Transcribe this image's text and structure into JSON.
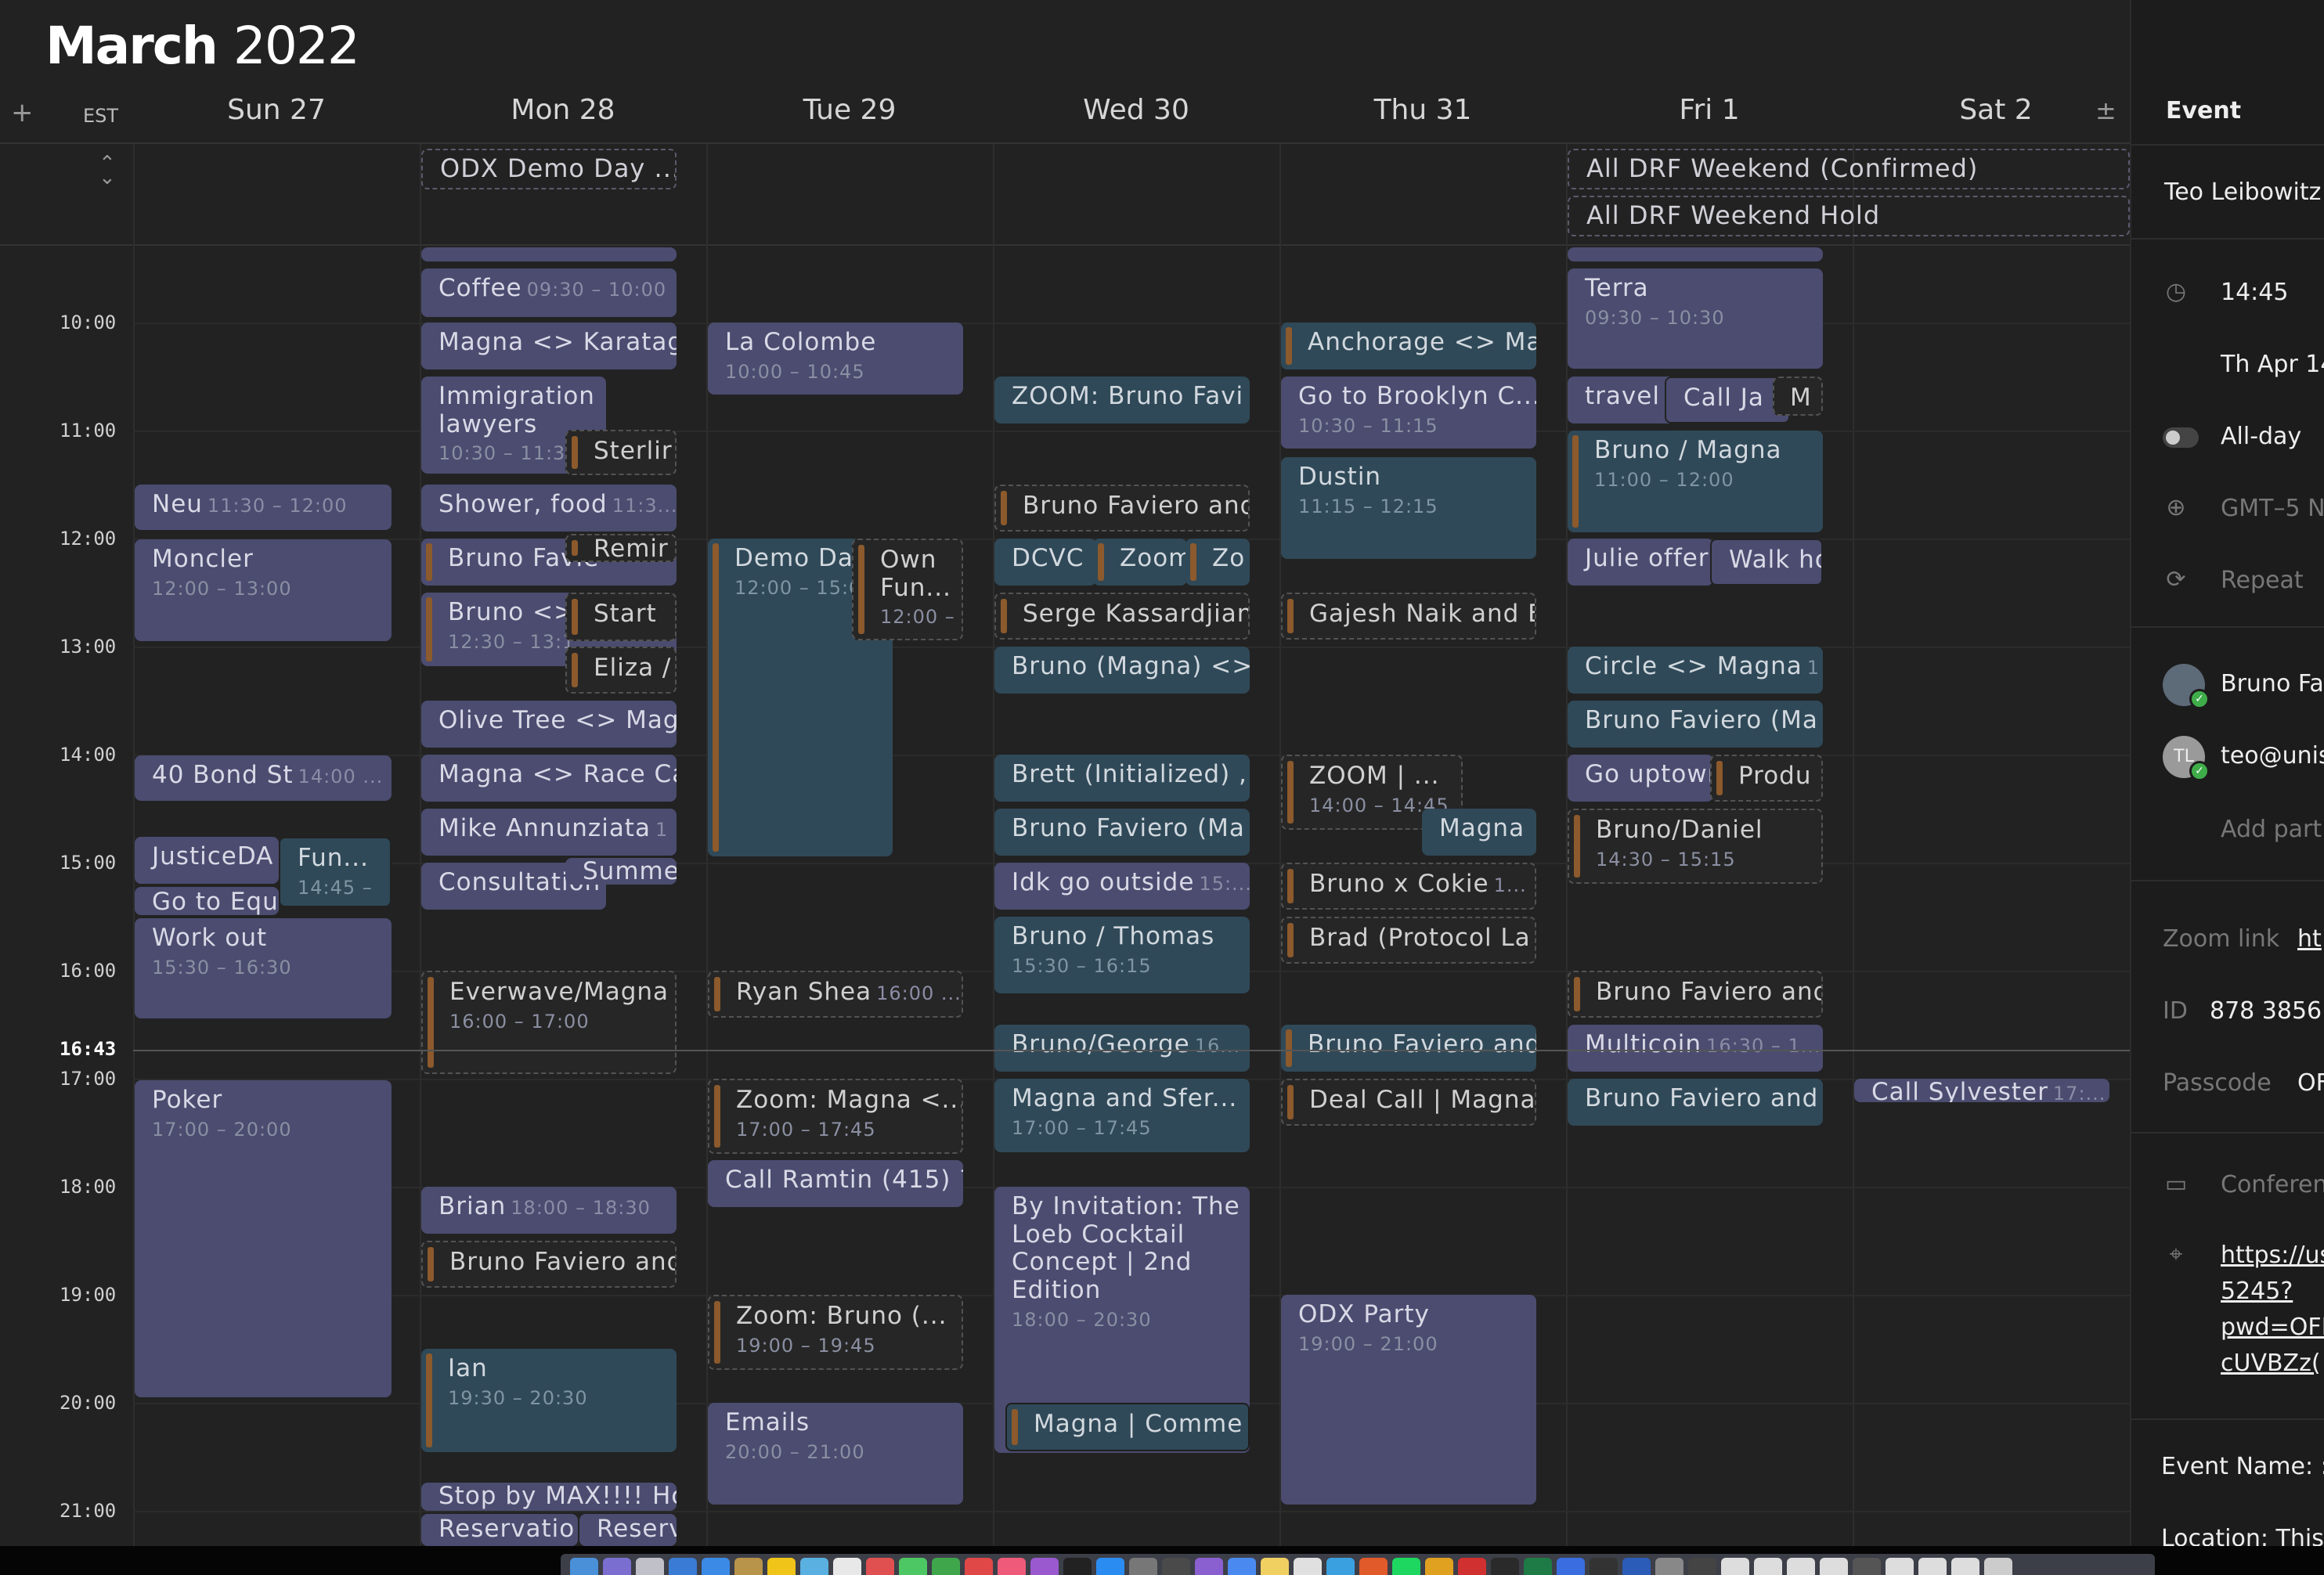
{
  "calendar": {
    "title_month": "March",
    "title_year": "2022",
    "add_symbol": "+",
    "timezone": "EST",
    "plus_minus": "±",
    "days": [
      "Sun 27",
      "Mon 28",
      "Tue 29",
      "Wed 30",
      "Thu 31",
      "Fri 1",
      "Sat 2"
    ],
    "hours": [
      "10:00",
      "11:00",
      "12:00",
      "13:00",
      "14:00",
      "15:00",
      "16:00",
      "17:00",
      "18:00",
      "19:00",
      "20:00",
      "21:00"
    ],
    "now": "16:43",
    "allday_events": [
      {
        "name": "ODX Demo Day ..."
      },
      {
        "name": "All DRF Weekend (Confirmed)"
      },
      {
        "name": "All DRF Weekend Hold"
      }
    ],
    "events": [
      {
        "name": "Neu",
        "time": "11:30 – 12:00"
      },
      {
        "name": "Moncler",
        "time": "12:00 – 13:00"
      },
      {
        "name": "40 Bond St",
        "time": "14:00 ..."
      },
      {
        "name": "JusticeDA",
        "time": ""
      },
      {
        "name": "Fun...",
        "time": "14:45 –"
      },
      {
        "name": "Go to Equi",
        "time": ""
      },
      {
        "name": "Work out",
        "time": "15:30 – 16:30"
      },
      {
        "name": "Poker",
        "time": "17:00 – 20:00"
      },
      {
        "name": "",
        "time": ""
      },
      {
        "name": "Coffee",
        "time": "09:30 – 10:00"
      },
      {
        "name": "Magna <> Karatag",
        "time": ""
      },
      {
        "name": "Immigration lawyers",
        "time": "10:30 – 11:30"
      },
      {
        "name": "Sterlir",
        "time": ""
      },
      {
        "name": "Shower, food",
        "time": "11:3..."
      },
      {
        "name": "Bruno Favie",
        "time": ""
      },
      {
        "name": "Remir",
        "time": ""
      },
      {
        "name": "Bruno <>",
        "time": "12:30 – 13:1"
      },
      {
        "name": "Start",
        "time": ""
      },
      {
        "name": "Eliza /",
        "time": ""
      },
      {
        "name": "Olive Tree <> Mag",
        "time": ""
      },
      {
        "name": "Magna <> Race Ca",
        "time": ""
      },
      {
        "name": "Mike Annunziata",
        "time": "1"
      },
      {
        "name": "Consultation",
        "time": ""
      },
      {
        "name": "Summe",
        "time": ""
      },
      {
        "name": "Everwave/Magna",
        "time": "16:00 – 17:00"
      },
      {
        "name": "Brian",
        "time": "18:00 – 18:30"
      },
      {
        "name": "Bruno Faviero and",
        "time": ""
      },
      {
        "name": "Ian",
        "time": "19:30 – 20:30"
      },
      {
        "name": "Stop by MAX!!!! Hc",
        "time": ""
      },
      {
        "name": "Reservatio",
        "time": ""
      },
      {
        "name": "Reserv",
        "time": ""
      },
      {
        "name": "La Colombe",
        "time": "10:00 – 10:45"
      },
      {
        "name": "Demo Da",
        "time": "12:00 – 15:0"
      },
      {
        "name": "Own Fun...",
        "time": "12:00 –"
      },
      {
        "name": "Ryan Shea",
        "time": "16:00 ..."
      },
      {
        "name": "Zoom: Magna <...",
        "time": "17:00 – 17:45"
      },
      {
        "name": "Call Ramtin (415) 7",
        "time": ""
      },
      {
        "name": "Zoom: Bruno (...",
        "time": "19:00 – 19:45"
      },
      {
        "name": "Emails",
        "time": "20:00 – 21:00"
      },
      {
        "name": "ZOOM: Bruno Favi",
        "time": ""
      },
      {
        "name": "Bruno Faviero and",
        "time": ""
      },
      {
        "name": "DCVC",
        "time": ""
      },
      {
        "name": "Zoom",
        "time": ""
      },
      {
        "name": "Zo",
        "time": ""
      },
      {
        "name": "Serge Kassardjian",
        "time": ""
      },
      {
        "name": "Bruno (Magna) <>",
        "time": ""
      },
      {
        "name": "Brett (Initialized) ,",
        "time": ""
      },
      {
        "name": "Bruno Faviero (Ma",
        "time": ""
      },
      {
        "name": "Idk go outside",
        "time": "15:..."
      },
      {
        "name": "Bruno / Thomas",
        "time": "15:30 – 16:15"
      },
      {
        "name": "Bruno/George",
        "time": "16..."
      },
      {
        "name": "Magna and Sfer...",
        "time": "17:00 – 17:45"
      },
      {
        "name": "By Invitation: The Loeb Cocktail Concept | 2nd Edition",
        "time": "18:00 – 20:30"
      },
      {
        "name": "Magna | Comme",
        "time": ""
      },
      {
        "name": "Anchorage <> Ma",
        "time": ""
      },
      {
        "name": "Go to Brooklyn C...",
        "time": "10:30 – 11:15"
      },
      {
        "name": "Dustin",
        "time": "11:15 – 12:15"
      },
      {
        "name": "Gajesh Naik and E",
        "time": ""
      },
      {
        "name": "ZOOM | ...",
        "time": "14:00 – 14:45"
      },
      {
        "name": "Magna",
        "time": ""
      },
      {
        "name": "Bruno x Cokie",
        "time": "1..."
      },
      {
        "name": "Brad (Protocol La",
        "time": ""
      },
      {
        "name": "Bruno Faviero and",
        "time": ""
      },
      {
        "name": "Deal Call | Magna",
        "time": ""
      },
      {
        "name": "ODX Party",
        "time": "19:00 – 21:00"
      },
      {
        "name": "",
        "time": ""
      },
      {
        "name": "Terra",
        "time": "09:30 – 10:30"
      },
      {
        "name": "travel",
        "time": ""
      },
      {
        "name": "Call Ja",
        "time": ""
      },
      {
        "name": "M",
        "time": ""
      },
      {
        "name": "Bruno / Magna",
        "time": "11:00 – 12:00"
      },
      {
        "name": "Julie offer",
        "time": ""
      },
      {
        "name": "Walk ho",
        "time": ""
      },
      {
        "name": "Circle <> Magna",
        "time": "1"
      },
      {
        "name": "Bruno Faviero (Ma",
        "time": ""
      },
      {
        "name": "Go uptowr",
        "time": ""
      },
      {
        "name": "Produ",
        "time": ""
      },
      {
        "name": "Bruno/Daniel",
        "time": "14:30 – 15:15"
      },
      {
        "name": "Bruno Faviero and",
        "time": ""
      },
      {
        "name": "Multicoin",
        "time": "16:30 – 1..."
      },
      {
        "name": "Bruno Faviero and",
        "time": ""
      },
      {
        "name": "Call Sylvester",
        "time": "17:..."
      }
    ]
  },
  "sidebar": {
    "header": "Event",
    "organizer": "Teo Leibowitz",
    "time": "14:45",
    "date": "Th Apr 14",
    "allday_label": "All-day",
    "timezone": "GMT–5 N",
    "repeat_label": "Repeat",
    "attendees": [
      {
        "name": "Bruno Fa",
        "initials": "",
        "confirmed": true
      },
      {
        "name": "teo@unis",
        "initials": "TL",
        "confirmed": true
      }
    ],
    "add_participant": "Add part",
    "zoom_link_label": "Zoom link",
    "zoom_link_value": "ht",
    "id_label": "ID",
    "id_value": "878 3856",
    "passcode_label": "Passcode",
    "passcode_value": "OF",
    "conference_label": "Conferen",
    "location_lines": [
      "https://us",
      "5245?",
      "pwd=OFI",
      "cUVBZz("
    ],
    "event_name": "Event Name: :",
    "location": "Location: This"
  },
  "colors": {
    "purple": "#4b4c70",
    "teal": "#2f4958",
    "accent_bar": "#8c5a2c",
    "confirmed": "#3fae4a"
  }
}
